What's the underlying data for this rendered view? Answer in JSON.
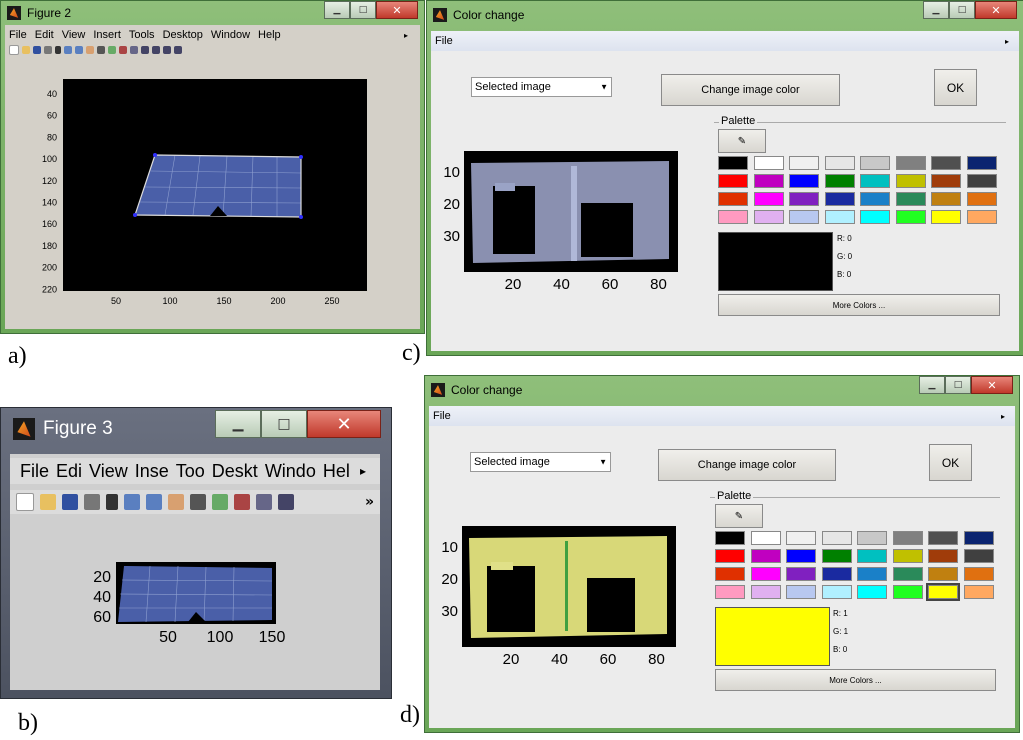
{
  "labels": {
    "a": "a)",
    "b": "b)",
    "c": "c)",
    "d": "d)"
  },
  "figure2": {
    "title": "Figure 2",
    "menus": [
      "File",
      "Edit",
      "View",
      "Insert",
      "Tools",
      "Desktop",
      "Window",
      "Help"
    ],
    "menu_arrow": "▸",
    "yticks": [
      "40",
      "60",
      "80",
      "100",
      "120",
      "140",
      "160",
      "180",
      "200",
      "220"
    ],
    "xticks": [
      "50",
      "100",
      "150",
      "200",
      "250"
    ]
  },
  "figure3": {
    "title": "Figure 3",
    "menus": [
      "File",
      "Edi",
      "View",
      "Inse",
      "Too",
      "Deskt",
      "Windo",
      "Hel"
    ],
    "menu_arrow": "▸",
    "toolbar_more": "»",
    "yticks": [
      "20",
      "40",
      "60"
    ],
    "xticks": [
      "50",
      "100",
      "150"
    ]
  },
  "color_change_c": {
    "title": "Color change",
    "menu_file": "File",
    "select_value": "Selected image",
    "change_button": "Change image color",
    "ok_button": "OK",
    "palette_label": "Palette",
    "picker_icon": "eyedropper-icon",
    "more_colors": "More Colors ...",
    "r": "R: 0",
    "g": "G: 0",
    "b": "B: 0",
    "preview_color": "#000000",
    "yticks": [
      "10",
      "20",
      "30"
    ],
    "xticks": [
      "20",
      "40",
      "60",
      "80"
    ]
  },
  "color_change_d": {
    "title": "Color change",
    "menu_file": "File",
    "select_value": "Selected image",
    "change_button": "Change image color",
    "ok_button": "OK",
    "palette_label": "Palette",
    "picker_icon": "eyedropper-icon",
    "more_colors": "More Colors ...",
    "r": "R: 1",
    "g": "G: 1",
    "b": "B: 0",
    "preview_color": "#ffff00",
    "yticks": [
      "10",
      "20",
      "30"
    ],
    "xticks": [
      "20",
      "40",
      "60",
      "80"
    ]
  },
  "palette_colors": [
    "#000000",
    "#ffffff",
    "#f0f0f0",
    "#e6e6e6",
    "#c8c8c8",
    "#808080",
    "#505050",
    "#0b2470",
    "#ff0000",
    "#c000c0",
    "#0000ff",
    "#008000",
    "#00c0c0",
    "#c0c000",
    "#a03c0a",
    "#404040",
    "#e03000",
    "#ff00ff",
    "#8020c0",
    "#1a2aa0",
    "#1a80c8",
    "#2a8a5a",
    "#c08010",
    "#e07010",
    "#ff9ac0",
    "#e0b0f0",
    "#b8c8f0",
    "#b0f0ff",
    "#00ffff",
    "#20ff20",
    "#ffff00",
    "#ffa860"
  ]
}
